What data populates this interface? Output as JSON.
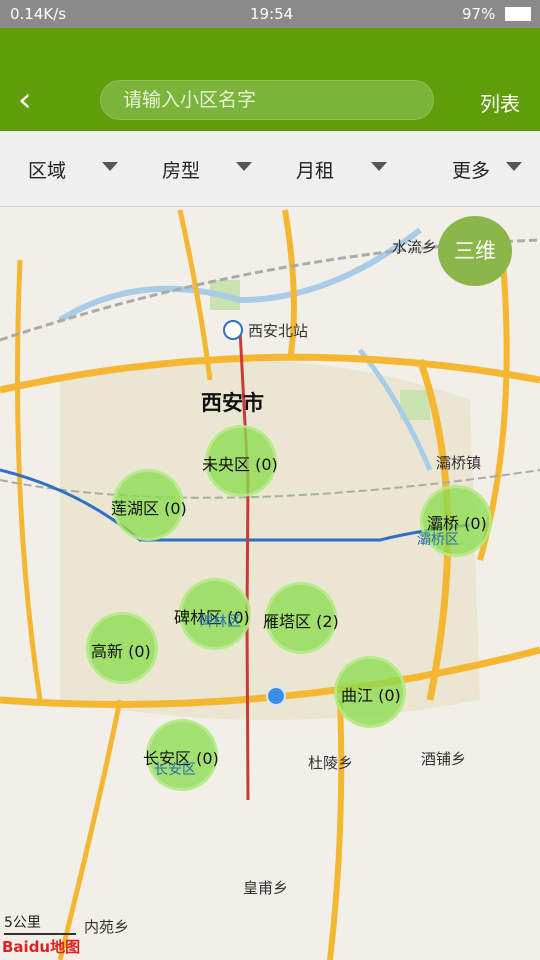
{
  "status": {
    "net": "0.14K/s",
    "time": "19:54",
    "battery": "97%"
  },
  "header": {
    "search_placeholder": "请输入小区名字",
    "list_label": "列表",
    "back_icon": "‹"
  },
  "filters": [
    {
      "label": "区域"
    },
    {
      "label": "房型"
    },
    {
      "label": "月租"
    },
    {
      "label": "更多"
    }
  ],
  "map": {
    "city": "西安市",
    "station": "西安北站",
    "places": [
      "水流乡",
      "灞桥镇",
      "杜陵乡",
      "酒铺乡",
      "皇甫乡",
      "内苑乡",
      "碑林区",
      "灞桥区",
      "长安区"
    ],
    "three_d": "三维",
    "scale": "5公里",
    "logo": "Baidu地图"
  },
  "districts": [
    {
      "name": "未央区",
      "count": "(0)"
    },
    {
      "name": "莲湖区",
      "count": "(0)"
    },
    {
      "name": "灞桥",
      "count": "(0)"
    },
    {
      "name": "碑林区",
      "count": "(0)"
    },
    {
      "name": "雁塔区",
      "count": "(2)"
    },
    {
      "name": "高新",
      "count": "(0)"
    },
    {
      "name": "曲江",
      "count": "(0)"
    },
    {
      "name": "长安区",
      "count": "(0)"
    }
  ],
  "colors": {
    "appbar": "#5f9e0a",
    "bubble": "#8cdc50",
    "road": "#f5b731"
  }
}
